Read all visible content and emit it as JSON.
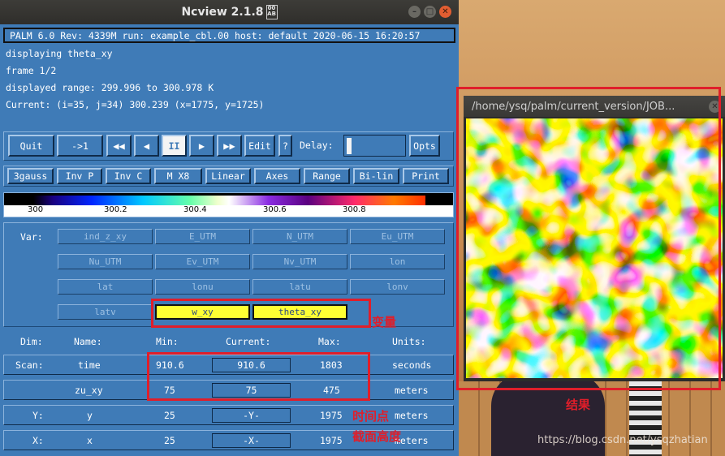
{
  "window": {
    "title": "Ncview 2.1.8",
    "title_icon": "ncview-icon"
  },
  "info": {
    "banner": "PALM 6.0  Rev: 4339M  run: example_cbl.00  host: default  2020-06-15 16:20:57",
    "displaying": "displaying theta_xy",
    "frame": "frame 1/2",
    "range": "displayed range: 299.996 to 300.978 K",
    "current": "Current: (i=35, j=34) 300.239 (x=1775, y=1725)"
  },
  "controls": {
    "quit": "Quit",
    "step": "->1",
    "rewind": "◀◀",
    "back": "◀",
    "pause": "II",
    "forward": "▶",
    "fastforward": "▶▶",
    "edit": "Edit",
    "help": "?",
    "delay_label": "Delay:",
    "opts": "Opts"
  },
  "toolbar": [
    "3gauss",
    "Inv P",
    "Inv C",
    "M X8",
    "Linear",
    "Axes",
    "Range",
    "Bi-lin",
    "Print"
  ],
  "colorbar": {
    "ticks": [
      "300",
      "300.2",
      "300.4",
      "300.6",
      "300.8"
    ]
  },
  "var": {
    "label": "Var:",
    "buttons": [
      "ind_z_xy",
      "E_UTM",
      "N_UTM",
      "Eu_UTM",
      "Nu_UTM",
      "Ev_UTM",
      "Nv_UTM",
      "lon",
      "lat",
      "lonu",
      "latu",
      "lonv",
      "latv",
      "w_xy",
      "theta_xy"
    ],
    "active": [
      "w_xy",
      "theta_xy"
    ]
  },
  "dims": {
    "headers": [
      "Dim:",
      "Name:",
      "Min:",
      "Current:",
      "Max:",
      "Units:"
    ],
    "rows": [
      {
        "dim": "Scan:",
        "name": "time",
        "min": "910.6",
        "current": "910.6",
        "max": "1803",
        "units": "seconds"
      },
      {
        "dim": "",
        "name": "zu_xy",
        "min": "75",
        "current": "75",
        "max": "475",
        "units": "meters"
      },
      {
        "dim": "Y:",
        "name": "y",
        "min": "25",
        "current": "-Y-",
        "max": "1975",
        "units": "meters"
      },
      {
        "dim": "X:",
        "name": "x",
        "min": "25",
        "current": "-X-",
        "max": "1975",
        "units": "meters"
      }
    ]
  },
  "annotations": {
    "variable": "变量",
    "time_point": "时间点",
    "section_height": "截面高度",
    "result": "结果"
  },
  "plot": {
    "title": "/home/ysq/palm/current_version/JOB..."
  },
  "watermark": "https://blog.csdn.net/ysqzhatian",
  "colors": {
    "panel": "#3f7bb7",
    "active": "#ffff33",
    "annotation": "#e01e2a"
  }
}
